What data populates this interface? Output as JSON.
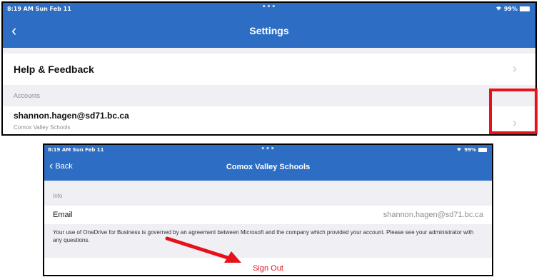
{
  "screen1": {
    "status": {
      "time_date": "8:19 AM  Sun Feb 11",
      "dots": "•••",
      "battery": "99%"
    },
    "nav": {
      "back_glyph": "‹",
      "title": "Settings"
    },
    "help_row": {
      "label": "Help & Feedback"
    },
    "accounts_header": "Accounts",
    "account_row": {
      "email": "shannon.hagen@sd71.bc.ca",
      "org": "Comox Valley Schools"
    }
  },
  "screen2": {
    "status": {
      "time_date": "8:19 AM  Sun Feb 11",
      "dots": "•••",
      "battery": "99%"
    },
    "nav": {
      "back_label": "Back",
      "title": "Comox Valley Schools"
    },
    "info_header": "Info",
    "email_row": {
      "label": "Email",
      "value": "shannon.hagen@sd71.bc.ca"
    },
    "note": "Your use of OneDrive for Business is governed by an agreement between Microsoft and the company which provided your account. Please see your administrator with any questions.",
    "signout_label": "Sign Out"
  },
  "colors": {
    "nav_blue": "#2d6ec4",
    "highlight_red": "#e6121b",
    "signout_red": "#e6121b"
  },
  "icons": [
    "chevron-left-icon",
    "chevron-right-icon",
    "wifi-icon",
    "battery-icon"
  ]
}
